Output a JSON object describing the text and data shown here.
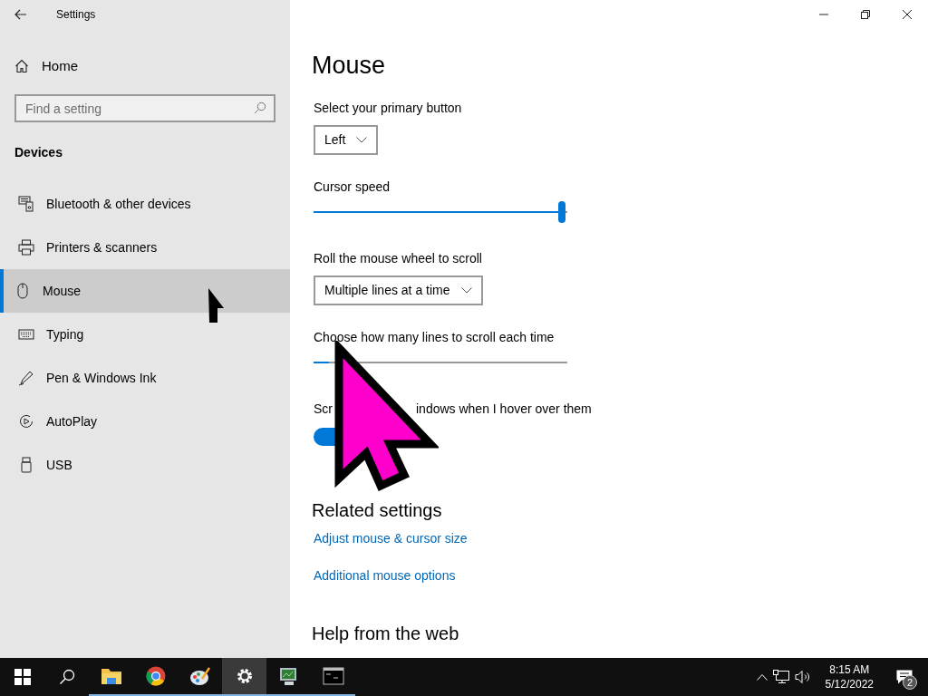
{
  "window": {
    "title": "Settings"
  },
  "sidebar": {
    "home": "Home",
    "search": {
      "placeholder": "Find a setting"
    },
    "section": "Devices",
    "items": [
      {
        "label": "Bluetooth & other devices",
        "selected": false
      },
      {
        "label": "Printers & scanners",
        "selected": false
      },
      {
        "label": "Mouse",
        "selected": true
      },
      {
        "label": "Typing",
        "selected": false
      },
      {
        "label": "Pen & Windows Ink",
        "selected": false
      },
      {
        "label": "AutoPlay",
        "selected": false
      },
      {
        "label": "USB",
        "selected": false
      }
    ]
  },
  "page": {
    "title": "Mouse",
    "settings": [
      {
        "kind": "dropdown",
        "label": "Select your primary button",
        "value": "Left"
      },
      {
        "kind": "slider",
        "label": "Cursor speed",
        "level": 0.98,
        "thumb_shown": true
      },
      {
        "kind": "dropdown",
        "label": "Roll the mouse wheel to scroll",
        "value": "Multiple lines at a time"
      },
      {
        "kind": "slider",
        "label": "Choose how many lines to scroll each time",
        "level": 0.06,
        "thumb_shown": false
      },
      {
        "kind": "toggle",
        "label": "Scr",
        "label_rest": "indows when I hover over them",
        "on": true
      }
    ],
    "related": {
      "title": "Related settings",
      "links": [
        "Adjust mouse & cursor size",
        "Additional mouse options"
      ]
    },
    "help_title": "Help from the web"
  },
  "taskbar": {
    "apps": [
      {
        "selected": false,
        "running": false
      },
      {
        "selected": false,
        "running": false
      },
      {
        "selected": false,
        "running": true
      },
      {
        "selected": false,
        "running": true
      },
      {
        "selected": false,
        "running": true
      },
      {
        "selected": true,
        "running": true
      },
      {
        "selected": false,
        "running": true
      },
      {
        "selected": false,
        "running": true
      }
    ],
    "tray": {
      "time": "8:15 AM",
      "date": "5/12/2022",
      "notifications": "2"
    }
  }
}
